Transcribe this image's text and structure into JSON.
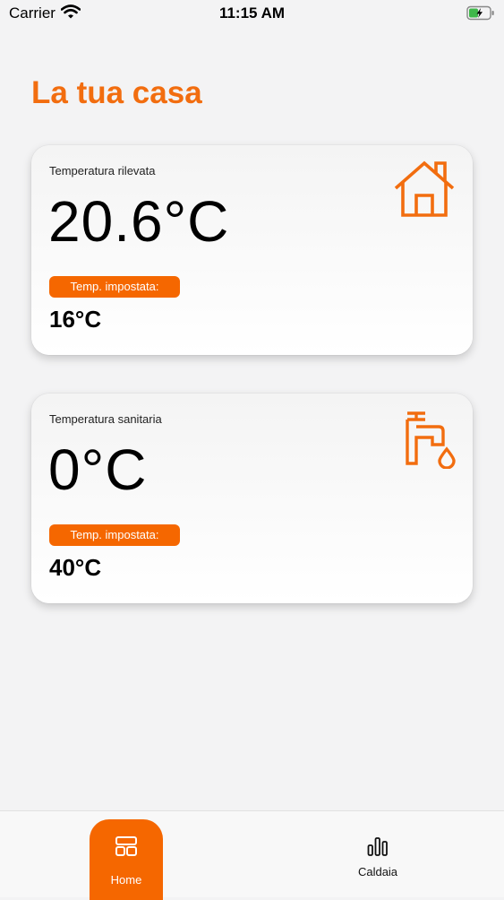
{
  "status_bar": {
    "carrier": "Carrier",
    "time": "11:15 AM",
    "battery_icon": "battery-charging-icon",
    "signal_icon": "wifi-icon"
  },
  "page": {
    "title": "La tua casa",
    "accent_color": "#f56700"
  },
  "cards": [
    {
      "label": "Temperatura rilevata",
      "value": "20.6°C",
      "badge": "Temp. impostata:",
      "set_value": "16°C",
      "icon": "house-icon"
    },
    {
      "label": "Temperatura sanitaria",
      "value": "0°C",
      "badge": "Temp. impostata:",
      "set_value": "40°C",
      "icon": "faucet-icon"
    }
  ],
  "tab_bar": {
    "tabs": [
      {
        "label": "Home",
        "icon": "dashboard-icon",
        "selected": true
      },
      {
        "label": "Caldaia",
        "icon": "bar-chart-icon",
        "selected": false
      }
    ]
  }
}
